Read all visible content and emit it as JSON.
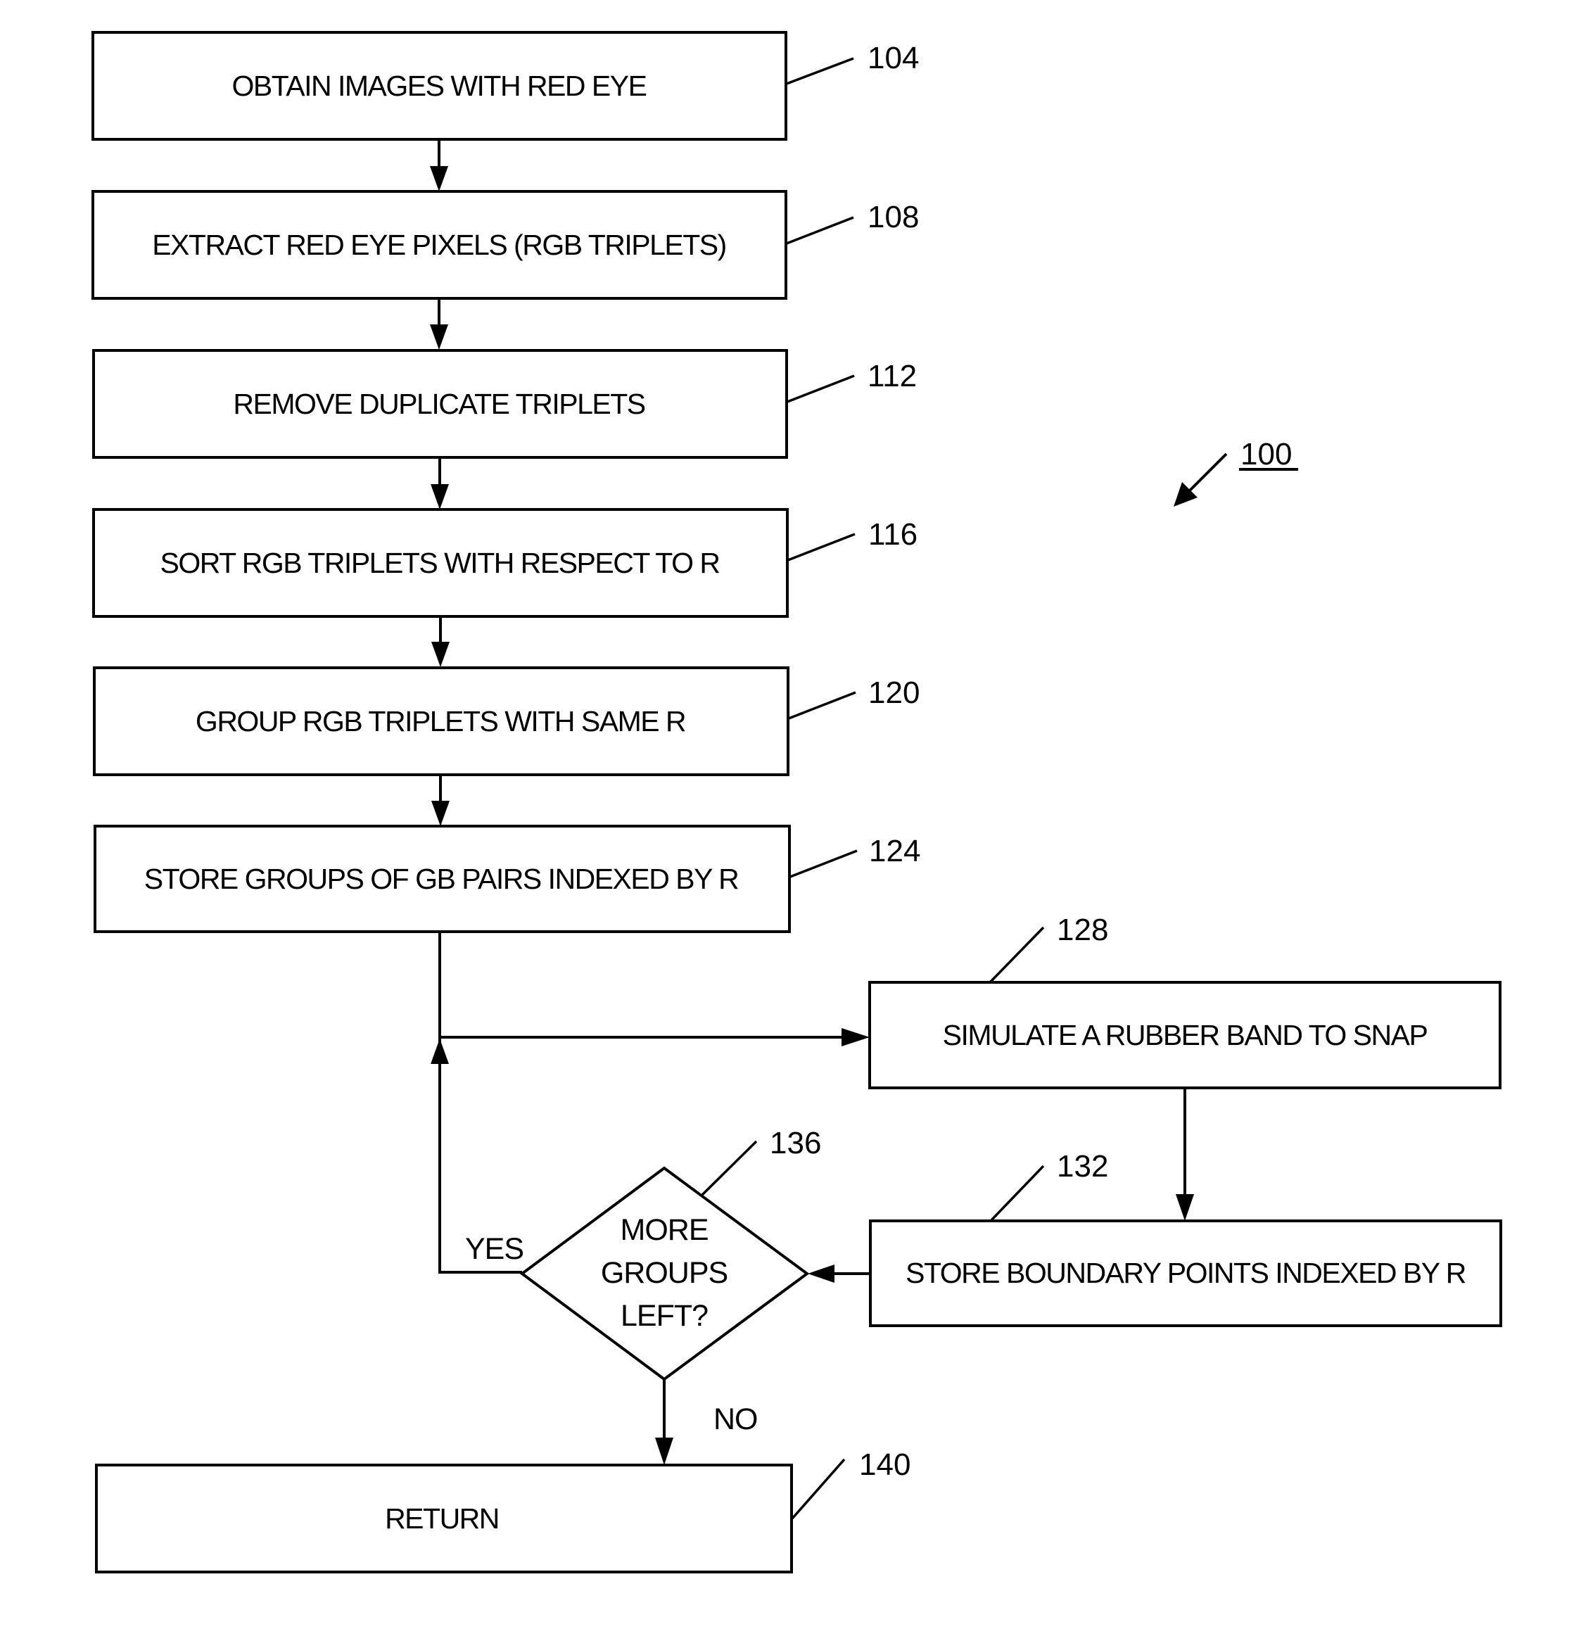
{
  "figure": {
    "reference": "100",
    "steps": [
      {
        "ref": "104",
        "label": "OBTAIN IMAGES WITH RED EYE"
      },
      {
        "ref": "108",
        "label": "EXTRACT RED EYE PIXELS (RGB TRIPLETS)"
      },
      {
        "ref": "112",
        "label": "REMOVE DUPLICATE TRIPLETS"
      },
      {
        "ref": "116",
        "label": "SORT RGB TRIPLETS WITH RESPECT TO R"
      },
      {
        "ref": "120",
        "label": "GROUP RGB TRIPLETS WITH SAME R"
      },
      {
        "ref": "124",
        "label": "STORE GROUPS OF GB PAIRS INDEXED BY R"
      },
      {
        "ref": "128",
        "label": "SIMULATE A RUBBER BAND TO SNAP"
      },
      {
        "ref": "132",
        "label": "STORE BOUNDARY POINTS INDEXED BY R"
      },
      {
        "ref": "140",
        "label": "RETURN"
      }
    ],
    "decision": {
      "ref": "136",
      "lines": [
        "MORE",
        "GROUPS",
        "LEFT?"
      ],
      "yes_label": "YES",
      "no_label": "NO"
    }
  }
}
